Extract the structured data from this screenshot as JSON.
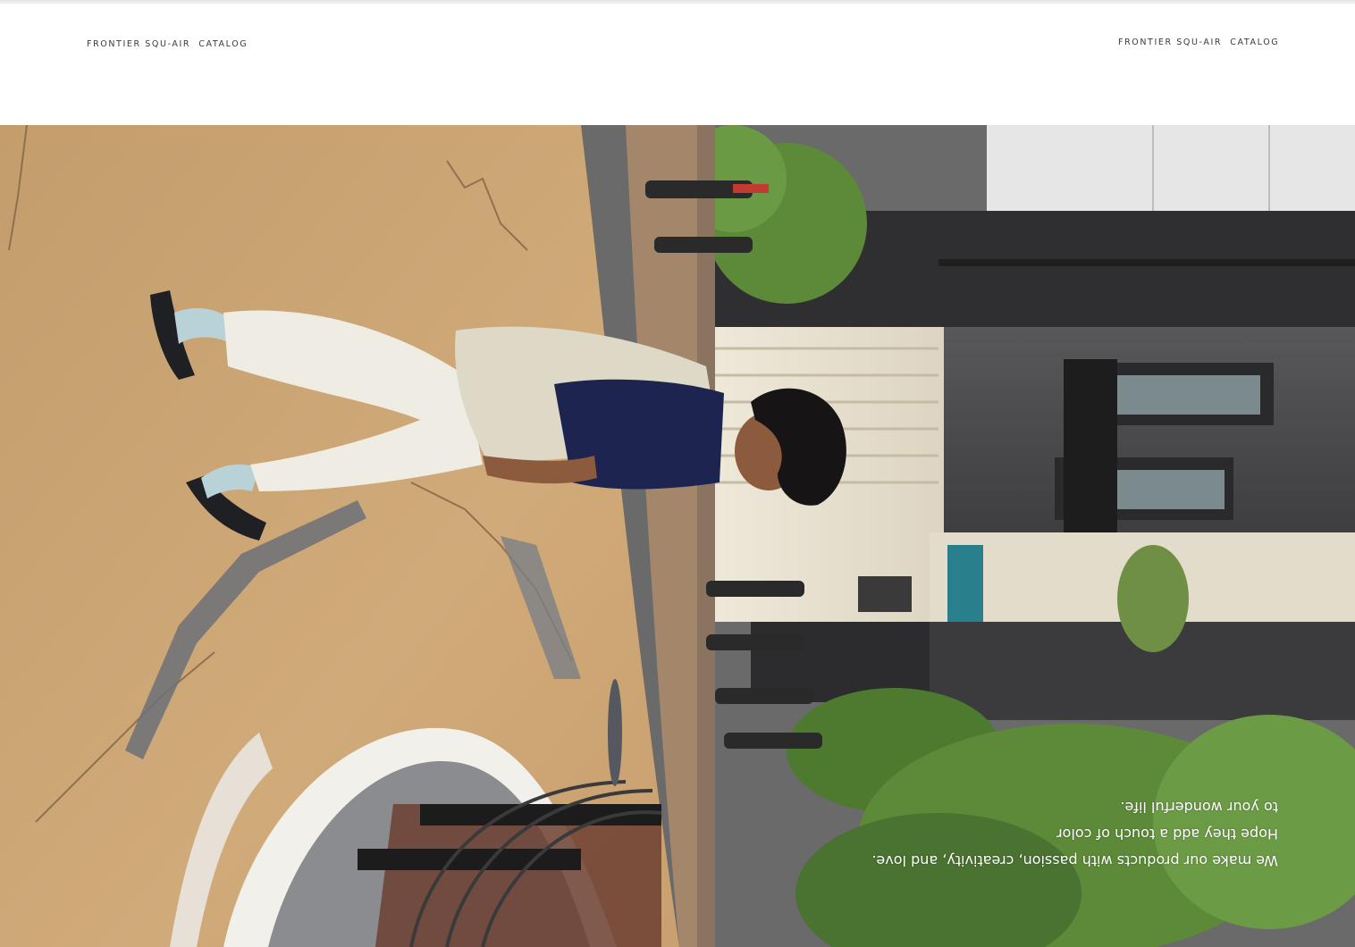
{
  "header": {
    "left_label": "FRONTIER SQU-AIR  CATALOG",
    "right_label": "FRONTIER SQU-AIR  CATALOG"
  },
  "photo": {
    "orientation": "upside-down",
    "caption": {
      "line1": "We make our products with passion, creativity, and love.",
      "line2": "Hope they add a touch of color",
      "line3": "to your wonderful life."
    }
  },
  "colors": {
    "pavement": "#c9a273",
    "building_dark": "#4a4a4c",
    "foliage": "#5e8a3a",
    "facade_light": "#e8e2d2",
    "accent_teal": "#2a7f8c"
  }
}
